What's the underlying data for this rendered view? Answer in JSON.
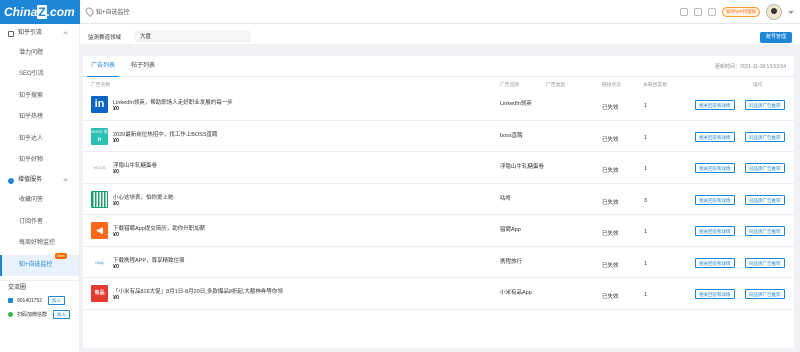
{
  "app": {
    "logo_text_a": "China",
    "logo_text_b": "Z",
    "logo_text_c": ".com",
    "breadcrumb": "知+自选监控",
    "vip_label": "知乎VIP代理商"
  },
  "colors": {
    "brand": "#1d86d6",
    "accent": "#ff6a00"
  },
  "sidebar": {
    "groups": [
      {
        "label": "知乎引流",
        "items": [
          "潜力问题",
          "SEO引流",
          "知乎搜索",
          "知乎热榜",
          "知乎达人",
          "知乎好物"
        ]
      },
      {
        "label": "增值服务",
        "items": [
          "收藏问答",
          "订阅作者",
          "每周好物监控",
          "知+自选监控"
        ]
      }
    ],
    "active_badge": "New",
    "jl_title": "交流圈",
    "jl_rows": [
      {
        "text": "901401752",
        "btn": "加入"
      },
      {
        "text": "扫码加微信群",
        "btn": "加入"
      }
    ]
  },
  "filter": {
    "label": "监测赛道领域",
    "select_value": "大盘",
    "manage_button": "账号管理"
  },
  "tabs": [
    "广告列表",
    "帖子列表"
  ],
  "updated": "更新时间：2021-11-18 13:53:54",
  "columns": [
    "广告名称",
    "广告品牌",
    "广告类型",
    "链接状态",
    "关联回答数",
    "操作"
  ],
  "actions": {
    "b1": "相关回答和详情",
    "b2": "同品牌广告推荐"
  },
  "rows": [
    {
      "title": "LinkedIn领英，帮助职场人走好职业发展的每一步",
      "price": "¥0",
      "brand": "LinkedIn领英",
      "status": "已失效",
      "count": "1",
      "thumb": "in"
    },
    {
      "title": "2020最新岗位热招中，找工作上BOSS直聘",
      "price": "¥0",
      "brand": "boss直聘",
      "status": "已失效",
      "count": "1",
      "thumb": "BOSS 直聘"
    },
    {
      "title": "浮隐山牛轧糖蛋卷",
      "price": "¥0",
      "brand": "浮隐山牛轧糖蛋卷",
      "status": "已失效",
      "count": "1",
      "thumb": "HOOS"
    },
    {
      "title": "小心这块表，怕你爱上她",
      "price": "¥0",
      "brand": "咕咚",
      "status": "已失效",
      "count": "3",
      "thumb": ""
    },
    {
      "title": "下载猎聘App提交简历，助你升职加薪",
      "price": "¥0",
      "brand": "猎聘App",
      "status": "已失效",
      "count": "1",
      "thumb": "◀"
    },
    {
      "title": "下载携程APP，尊享精致住宿",
      "price": "¥0",
      "brand": "携程旅行",
      "status": "已失效",
      "count": "1",
      "thumb": "Ctrip"
    },
    {
      "title": "「小米有品816大促」8月1日-8月20日,多款爆品8折起,大额神券等你领",
      "price": "¥0",
      "brand": "小米有品App",
      "status": "已失效",
      "count": "1",
      "thumb": "有品"
    }
  ]
}
